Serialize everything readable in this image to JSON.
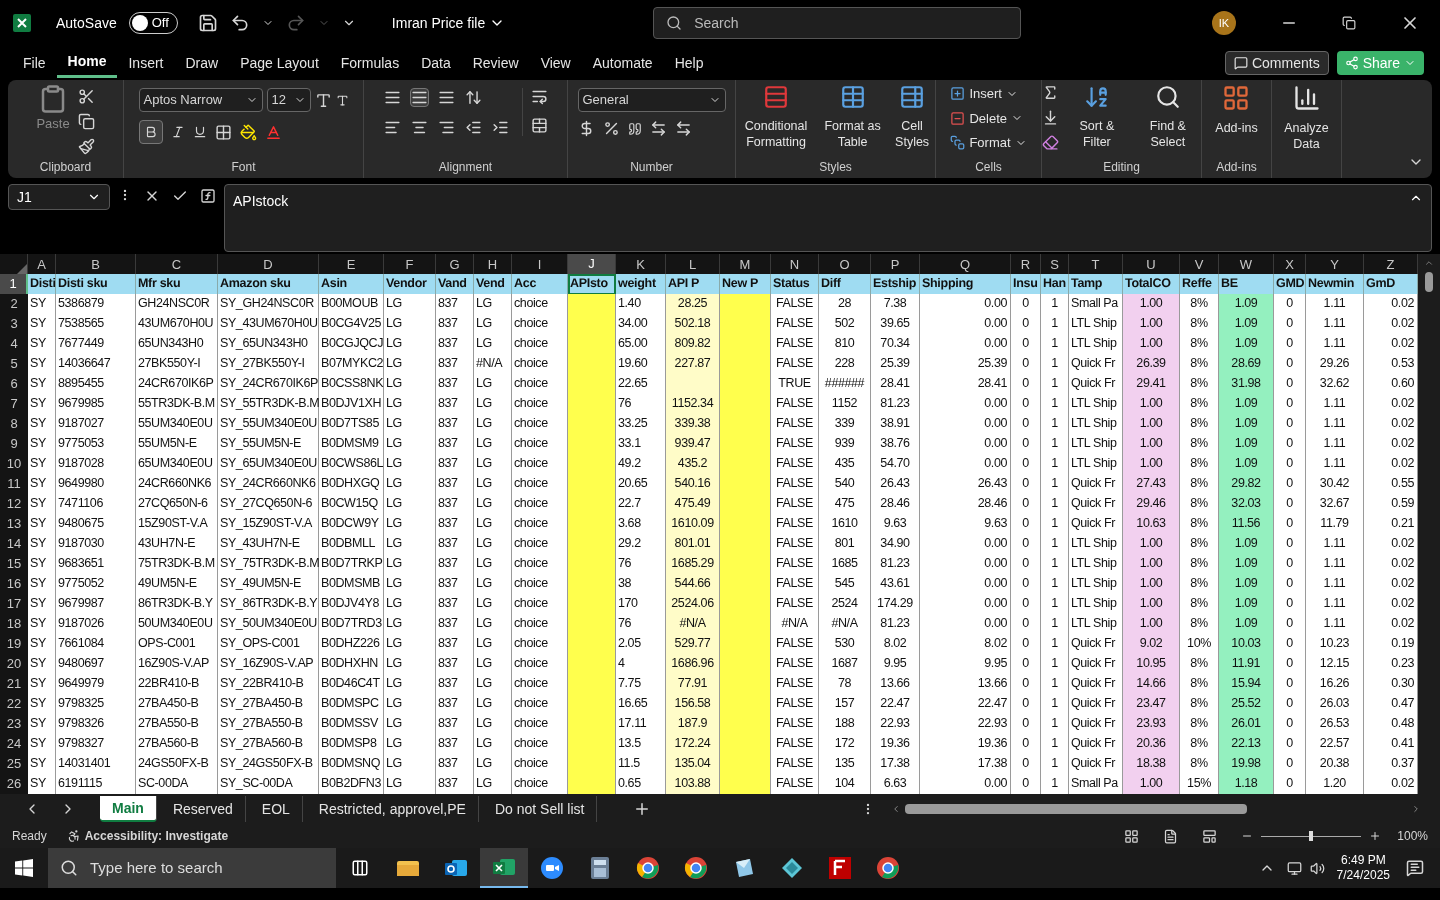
{
  "title_bar": {
    "autosave_label": "AutoSave",
    "autosave_on": false,
    "autosave_state": "Off",
    "file_name": "Imran Price file",
    "search_placeholder": "Search",
    "avatar": "IK"
  },
  "menu_tabs": [
    {
      "label": "File",
      "selected": false
    },
    {
      "label": "Home",
      "selected": true
    },
    {
      "label": "Insert",
      "selected": false
    },
    {
      "label": "Draw",
      "selected": false
    },
    {
      "label": "Page Layout",
      "selected": false
    },
    {
      "label": "Formulas",
      "selected": false
    },
    {
      "label": "Data",
      "selected": false
    },
    {
      "label": "Review",
      "selected": false
    },
    {
      "label": "View",
      "selected": false
    },
    {
      "label": "Automate",
      "selected": false
    },
    {
      "label": "Help",
      "selected": false
    }
  ],
  "comments": "Comments",
  "share": "Share",
  "ribbon": {
    "clipboard": {
      "paste": "Paste",
      "title": "Clipboard"
    },
    "font": {
      "name": "Aptos Narrow",
      "size": "12",
      "bold": true,
      "title": "Font"
    },
    "alignment": {
      "title": "Alignment"
    },
    "number": {
      "format": "General",
      "title": "Number"
    },
    "styles": {
      "buttons": [
        "Conditional Formatting",
        "Format as Table",
        "Cell Styles"
      ],
      "title": "Styles"
    },
    "cells": {
      "buttons": [
        "Insert",
        "Delete",
        "Format"
      ],
      "title": "Cells"
    },
    "editing": {
      "buttons": [
        "Sort & Filter",
        "Find & Select"
      ],
      "title": "Editing"
    },
    "addins": {
      "buttons": [
        "Add-ins",
        "Analyze Data"
      ],
      "title": "Add-ins"
    }
  },
  "formula_bar": {
    "name_box": "J1",
    "formula": "APIstock"
  },
  "columns": [
    {
      "letter": "A",
      "header": "Disti",
      "selected": false
    },
    {
      "letter": "B",
      "header": "Disti sku",
      "selected": false
    },
    {
      "letter": "C",
      "header": "Mfr sku",
      "selected": false
    },
    {
      "letter": "D",
      "header": "Amazon sku",
      "selected": false
    },
    {
      "letter": "E",
      "header": "Asin",
      "selected": false
    },
    {
      "letter": "F",
      "header": "Vendor",
      "selected": false
    },
    {
      "letter": "G",
      "header": "Vand",
      "selected": false
    },
    {
      "letter": "H",
      "header": "Vend",
      "selected": false
    },
    {
      "letter": "I",
      "header": "Acc",
      "selected": false
    },
    {
      "letter": "J",
      "header": "APIsto",
      "selected": true,
      "color": "#ffff4d"
    },
    {
      "letter": "K",
      "header": "weight",
      "selected": false
    },
    {
      "letter": "L",
      "header": "API P",
      "selected": false,
      "color": "#fffcc8"
    },
    {
      "letter": "M",
      "header": "New P",
      "selected": false,
      "color": "#ffff4d"
    },
    {
      "letter": "N",
      "header": "Status",
      "selected": false
    },
    {
      "letter": "O",
      "header": "Diff",
      "selected": false
    },
    {
      "letter": "P",
      "header": "Estship",
      "selected": false
    },
    {
      "letter": "Q",
      "header": "Shipping",
      "selected": false
    },
    {
      "letter": "R",
      "header": "Insu",
      "selected": false
    },
    {
      "letter": "S",
      "header": "Han",
      "selected": false
    },
    {
      "letter": "T",
      "header": "Tamp",
      "selected": false
    },
    {
      "letter": "U",
      "header": "TotalCO",
      "selected": false,
      "color": "#f2d0ef"
    },
    {
      "letter": "V",
      "header": "Reffe",
      "selected": false
    },
    {
      "letter": "W",
      "header": "BE",
      "selected": false,
      "color": "#94f0bf"
    },
    {
      "letter": "X",
      "header": "GMD",
      "selected": false
    },
    {
      "letter": "Y",
      "header": "Newmin",
      "selected": false
    },
    {
      "letter": "Z",
      "header": "GmD",
      "selected": false
    }
  ],
  "header_row": {
    "number": "1",
    "selected": true
  },
  "rows": [
    {
      "number": "2",
      "selected": false,
      "cells": [
        "SY",
        "5386879",
        "GH24NSC0R",
        "SY_GH24NSC0R",
        "B00MOUB",
        "LG",
        "837",
        "LG",
        "choice",
        null,
        "1.40",
        "28.25",
        null,
        "FALSE",
        "28",
        "7.38",
        "0.00",
        "0",
        "1",
        "Small Pa",
        "1.00",
        "8%",
        "1.09",
        "0",
        "1.11",
        "0.02"
      ]
    },
    {
      "number": "3",
      "selected": false,
      "cells": [
        "SY",
        "7538565",
        "43UM670H0U",
        "SY_43UM670H0U",
        "B0CG4V25",
        "LG",
        "837",
        "LG",
        "choice",
        null,
        "34.00",
        "502.18",
        null,
        "FALSE",
        "502",
        "39.65",
        "0.00",
        "0",
        "1",
        "LTL Ship",
        "1.00",
        "8%",
        "1.09",
        "0",
        "1.11",
        "0.02"
      ]
    },
    {
      "number": "4",
      "selected": false,
      "cells": [
        "SY",
        "7677449",
        "65UN343H0",
        "SY_65UN343H0",
        "B0CGJQCJ",
        "LG",
        "837",
        "LG",
        "choice",
        null,
        "65.00",
        "809.82",
        null,
        "FALSE",
        "810",
        "70.34",
        "0.00",
        "0",
        "1",
        "LTL Ship",
        "1.00",
        "8%",
        "1.09",
        "0",
        "1.11",
        "0.02"
      ]
    },
    {
      "number": "5",
      "selected": false,
      "cells": [
        "SY",
        "14036647",
        "27BK550Y-I",
        "SY_27BK550Y-I",
        "B07MYKC2",
        "LG",
        "837",
        "#N/A",
        "choice",
        null,
        "19.60",
        "227.87",
        null,
        "FALSE",
        "228",
        "25.39",
        "25.39",
        "0",
        "1",
        "Quick Fr",
        "26.39",
        "8%",
        "28.69",
        "0",
        "29.26",
        "0.53"
      ]
    },
    {
      "number": "6",
      "selected": false,
      "cells": [
        "SY",
        "8895455",
        "24CR670IK6P",
        "SY_24CR670IK6P",
        "B0CSS8NK",
        "LG",
        "837",
        "LG",
        "choice",
        null,
        "22.65",
        null,
        null,
        "TRUE",
        "######",
        "28.41",
        "28.41",
        "0",
        "1",
        "Quick Fr",
        "29.41",
        "8%",
        "31.98",
        "0",
        "32.62",
        "0.60"
      ]
    },
    {
      "number": "7",
      "selected": false,
      "cells": [
        "SY",
        "9679985",
        "55TR3DK-B.M",
        "SY_55TR3DK-B.M",
        "B0DJV1XH",
        "LG",
        "837",
        "LG",
        "choice",
        null,
        "76",
        "1152.34",
        null,
        "FALSE",
        "1152",
        "81.23",
        "0.00",
        "0",
        "1",
        "LTL Ship",
        "1.00",
        "8%",
        "1.09",
        "0",
        "1.11",
        "0.02"
      ]
    },
    {
      "number": "8",
      "selected": false,
      "cells": [
        "SY",
        "9187027",
        "55UM340E0U",
        "SY_55UM340E0U",
        "B0D7TS85",
        "LG",
        "837",
        "LG",
        "choice",
        null,
        "33.25",
        "339.38",
        null,
        "FALSE",
        "339",
        "38.91",
        "0.00",
        "0",
        "1",
        "LTL Ship",
        "1.00",
        "8%",
        "1.09",
        "0",
        "1.11",
        "0.02"
      ]
    },
    {
      "number": "9",
      "selected": false,
      "cells": [
        "SY",
        "9775053",
        "55UM5N-E",
        "SY_55UM5N-E",
        "B0DMSM9",
        "LG",
        "837",
        "LG",
        "choice",
        null,
        "33.1",
        "939.47",
        null,
        "FALSE",
        "939",
        "38.76",
        "0.00",
        "0",
        "1",
        "LTL Ship",
        "1.00",
        "8%",
        "1.09",
        "0",
        "1.11",
        "0.02"
      ]
    },
    {
      "number": "10",
      "selected": false,
      "cells": [
        "SY",
        "9187028",
        "65UM340E0U",
        "SY_65UM340E0U",
        "B0CWS86L",
        "LG",
        "837",
        "LG",
        "choice",
        null,
        "49.2",
        "435.2",
        null,
        "FALSE",
        "435",
        "54.70",
        "0.00",
        "0",
        "1",
        "LTL Ship",
        "1.00",
        "8%",
        "1.09",
        "0",
        "1.11",
        "0.02"
      ]
    },
    {
      "number": "11",
      "selected": false,
      "cells": [
        "SY",
        "9649980",
        "24CR660NK6",
        "SY_24CR660NK6",
        "B0DHXGQ",
        "LG",
        "837",
        "LG",
        "choice",
        null,
        "20.65",
        "540.16",
        null,
        "FALSE",
        "540",
        "26.43",
        "26.43",
        "0",
        "1",
        "Quick Fr",
        "27.43",
        "8%",
        "29.82",
        "0",
        "30.42",
        "0.55"
      ]
    },
    {
      "number": "12",
      "selected": false,
      "cells": [
        "SY",
        "7471106",
        "27CQ650N-6",
        "SY_27CQ650N-6",
        "B0CW15Q",
        "LG",
        "837",
        "LG",
        "choice",
        null,
        "22.7",
        "475.49",
        null,
        "FALSE",
        "475",
        "28.46",
        "28.46",
        "0",
        "1",
        "Quick Fr",
        "29.46",
        "8%",
        "32.03",
        "0",
        "32.67",
        "0.59"
      ]
    },
    {
      "number": "13",
      "selected": false,
      "cells": [
        "SY",
        "9480675",
        "15Z90ST-V.A",
        "SY_15Z90ST-V.A",
        "B0DCW9Y",
        "LG",
        "837",
        "LG",
        "choice",
        null,
        "3.68",
        "1610.09",
        null,
        "FALSE",
        "1610",
        "9.63",
        "9.63",
        "0",
        "1",
        "Quick Fr",
        "10.63",
        "8%",
        "11.56",
        "0",
        "11.79",
        "0.21"
      ]
    },
    {
      "number": "14",
      "selected": false,
      "cells": [
        "SY",
        "9187030",
        "43UH7N-E",
        "SY_43UH7N-E",
        "B0DBMLL",
        "LG",
        "837",
        "LG",
        "choice",
        null,
        "29.2",
        "801.01",
        null,
        "FALSE",
        "801",
        "34.90",
        "0.00",
        "0",
        "1",
        "LTL Ship",
        "1.00",
        "8%",
        "1.09",
        "0",
        "1.11",
        "0.02"
      ]
    },
    {
      "number": "15",
      "selected": false,
      "cells": [
        "SY",
        "9683651",
        "75TR3DK-B.M",
        "SY_75TR3DK-B.M",
        "B0D7TRKP",
        "LG",
        "837",
        "LG",
        "choice",
        null,
        "76",
        "1685.29",
        null,
        "FALSE",
        "1685",
        "81.23",
        "0.00",
        "0",
        "1",
        "LTL Ship",
        "1.00",
        "8%",
        "1.09",
        "0",
        "1.11",
        "0.02"
      ]
    },
    {
      "number": "16",
      "selected": false,
      "cells": [
        "SY",
        "9775052",
        "49UM5N-E",
        "SY_49UM5N-E",
        "B0DMSMB",
        "LG",
        "837",
        "LG",
        "choice",
        null,
        "38",
        "544.66",
        null,
        "FALSE",
        "545",
        "43.61",
        "0.00",
        "0",
        "1",
        "LTL Ship",
        "1.00",
        "8%",
        "1.09",
        "0",
        "1.11",
        "0.02"
      ]
    },
    {
      "number": "17",
      "selected": false,
      "cells": [
        "SY",
        "9679987",
        "86TR3DK-B.Y",
        "SY_86TR3DK-B.Y",
        "B0DJV4Y8",
        "LG",
        "837",
        "LG",
        "choice",
        null,
        "170",
        "2524.06",
        null,
        "FALSE",
        "2524",
        "174.29",
        "0.00",
        "0",
        "1",
        "LTL Ship",
        "1.00",
        "8%",
        "1.09",
        "0",
        "1.11",
        "0.02"
      ]
    },
    {
      "number": "18",
      "selected": false,
      "cells": [
        "SY",
        "9187026",
        "50UM340E0U",
        "SY_50UM340E0U",
        "B0D7TRD3",
        "LG",
        "837",
        "LG",
        "choice",
        null,
        "76",
        "#N/A",
        null,
        "#N/A",
        "#N/A",
        "81.23",
        "0.00",
        "0",
        "1",
        "LTL Ship",
        "1.00",
        "8%",
        "1.09",
        "0",
        "1.11",
        "0.02"
      ]
    },
    {
      "number": "19",
      "selected": false,
      "cells": [
        "SY",
        "7661084",
        "OPS-C001",
        "SY_OPS-C001",
        "B0DHZ226",
        "LG",
        "837",
        "LG",
        "choice",
        null,
        "2.05",
        "529.77",
        null,
        "FALSE",
        "530",
        "8.02",
        "8.02",
        "0",
        "1",
        "Quick Fr",
        "9.02",
        "10%",
        "10.03",
        "0",
        "10.23",
        "0.19"
      ]
    },
    {
      "number": "20",
      "selected": false,
      "cells": [
        "SY",
        "9480697",
        "16Z90S-V.AP",
        "SY_16Z90S-V.AP",
        "B0DHXHN",
        "LG",
        "837",
        "LG",
        "choice",
        null,
        "4",
        "1686.96",
        null,
        "FALSE",
        "1687",
        "9.95",
        "9.95",
        "0",
        "1",
        "Quick Fr",
        "10.95",
        "8%",
        "11.91",
        "0",
        "12.15",
        "0.23"
      ]
    },
    {
      "number": "21",
      "selected": false,
      "cells": [
        "SY",
        "9649979",
        "22BR410-B",
        "SY_22BR410-B",
        "B0D46C4T",
        "LG",
        "837",
        "LG",
        "choice",
        null,
        "7.75",
        "77.91",
        null,
        "FALSE",
        "78",
        "13.66",
        "13.66",
        "0",
        "1",
        "Quick Fr",
        "14.66",
        "8%",
        "15.94",
        "0",
        "16.26",
        "0.30"
      ]
    },
    {
      "number": "22",
      "selected": false,
      "cells": [
        "SY",
        "9798325",
        "27BA450-B",
        "SY_27BA450-B",
        "B0DMSPC",
        "LG",
        "837",
        "LG",
        "choice",
        null,
        "16.65",
        "156.58",
        null,
        "FALSE",
        "157",
        "22.47",
        "22.47",
        "0",
        "1",
        "Quick Fr",
        "23.47",
        "8%",
        "25.52",
        "0",
        "26.03",
        "0.47"
      ]
    },
    {
      "number": "23",
      "selected": false,
      "cells": [
        "SY",
        "9798326",
        "27BA550-B",
        "SY_27BA550-B",
        "B0DMSSV",
        "LG",
        "837",
        "LG",
        "choice",
        null,
        "17.11",
        "187.9",
        null,
        "FALSE",
        "188",
        "22.93",
        "22.93",
        "0",
        "1",
        "Quick Fr",
        "23.93",
        "8%",
        "26.01",
        "0",
        "26.53",
        "0.48"
      ]
    },
    {
      "number": "24",
      "selected": false,
      "cells": [
        "SY",
        "9798327",
        "27BA560-B",
        "SY_27BA560-B",
        "B0DMSP8",
        "LG",
        "837",
        "LG",
        "choice",
        null,
        "13.5",
        "172.24",
        null,
        "FALSE",
        "172",
        "19.36",
        "19.36",
        "0",
        "1",
        "Quick Fr",
        "20.36",
        "8%",
        "22.13",
        "0",
        "22.57",
        "0.41"
      ]
    },
    {
      "number": "25",
      "selected": false,
      "cells": [
        "SY",
        "14031401",
        "24GS50FX-B",
        "SY_24GS50FX-B",
        "B0DMSNQ",
        "LG",
        "837",
        "LG",
        "choice",
        null,
        "11.5",
        "135.04",
        null,
        "FALSE",
        "135",
        "17.38",
        "17.38",
        "0",
        "1",
        "Quick Fr",
        "18.38",
        "8%",
        "19.98",
        "0",
        "20.38",
        "0.37"
      ]
    },
    {
      "number": "26",
      "selected": false,
      "cells": [
        "SY",
        "6191115",
        "SC-00DA",
        "SY_SC-00DA",
        "B0B2DFN3",
        "LG",
        "837",
        "LG",
        "choice",
        null,
        "0.65",
        "103.88",
        null,
        "FALSE",
        "104",
        "6.63",
        "0.00",
        "0",
        "1",
        "Small Pa",
        "1.00",
        "15%",
        "1.18",
        "0",
        "1.20",
        "0.02"
      ]
    }
  ],
  "sheet_tabs": [
    {
      "label": "Main",
      "selected": true
    },
    {
      "label": "Reserved",
      "selected": false
    },
    {
      "label": "EOL",
      "selected": false
    },
    {
      "label": "Restricted, approvel,PE",
      "selected": false
    },
    {
      "label": "Do not Sell list",
      "selected": false
    }
  ],
  "status_bar": {
    "ready": "Ready",
    "accessibility": "Accessibility: Investigate",
    "zoom": "100%",
    "zoom_slider": {
      "level": 0.5
    }
  },
  "taskbar": {
    "search_placeholder": "Type here to search",
    "time": "6:49 PM",
    "date": "7/24/2025"
  }
}
